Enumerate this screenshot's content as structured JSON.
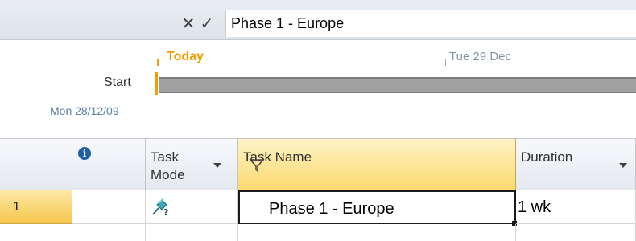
{
  "entry_bar": {
    "cancel_symbol": "✕",
    "confirm_symbol": "✓",
    "value": "Phase 1 - Europe"
  },
  "timeline": {
    "today_label": "Today",
    "date_label": "Tue 29 Dec",
    "start_label": "Start",
    "start_date": "Mon 28/12/09"
  },
  "grid": {
    "columns": {
      "indicators_icon": "i",
      "task_mode": [
        "Task",
        "Mode"
      ],
      "task_name": "Task Name",
      "duration": "Duration"
    },
    "rows": [
      {
        "id": "1",
        "task_mode_icon": "manual-schedule-pin-icon",
        "task_name": "Phase 1 - Europe",
        "duration": "1 wk"
      }
    ]
  },
  "colors": {
    "today_orange": "#f0a000",
    "selected_header": "#fbd970",
    "timeline_bar": "#a0a0a0",
    "date_blue": "#5b7fa6"
  }
}
